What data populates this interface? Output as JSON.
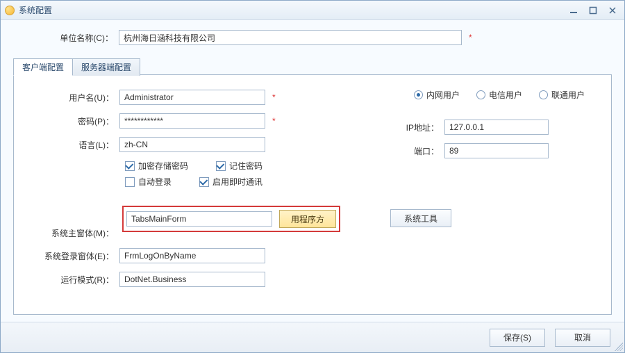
{
  "titlebar": {
    "title": "系统配置"
  },
  "top": {
    "org_label": "单位名称(C)：",
    "org_value": "杭州海日涵科技有限公司"
  },
  "tabs": {
    "client": "客户端配置",
    "server": "服务器端配置"
  },
  "client_tab": {
    "user_label": "用户名(U)：",
    "user_value": "Administrator",
    "pwd_label": "密码(P)：",
    "pwd_value": "************",
    "lang_label": "语言(L)：",
    "lang_value": "zh-CN",
    "chk_encrypt": "加密存储密码",
    "chk_remember": "记住密码",
    "chk_autologin": "自动登录",
    "chk_im": "启用即时通讯",
    "mainform_label": "系统主窗体(M)：",
    "mainform_value": "TabsMainForm",
    "btn_program": "用程序方",
    "logonform_label": "系统登录窗体(E)：",
    "logonform_value": "FrmLogOnByName",
    "runmode_label": "运行模式(R)：",
    "runmode_value": "DotNet.Business",
    "btn_systools": "系统工具"
  },
  "right": {
    "net": {
      "lan": "内网用户",
      "tel": "电信用户",
      "uni": "联通用户",
      "selected": "lan"
    },
    "ip_label": "IP地址：",
    "ip_value": "127.0.0.1",
    "port_label": "端口：",
    "port_value": "89"
  },
  "footer": {
    "save": "保存(S)",
    "cancel": "取消"
  }
}
